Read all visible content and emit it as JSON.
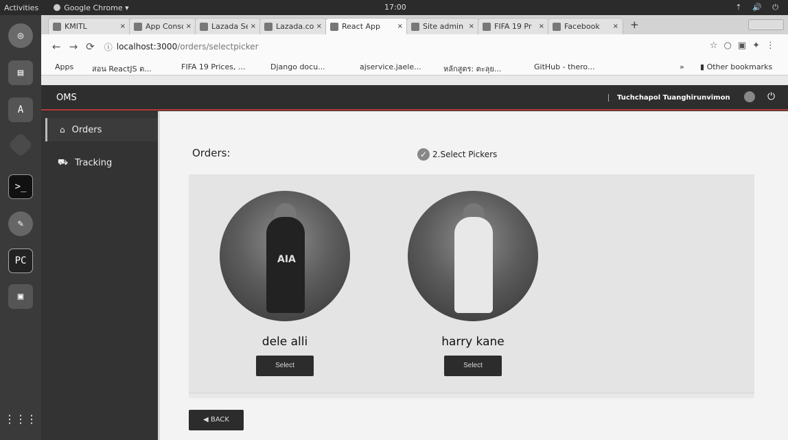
{
  "topbar": {
    "activities": "Activities",
    "app": "Google Chrome ▾",
    "clock": "17:00",
    "indicators": "⇡ 🔊 ⏻"
  },
  "browser": {
    "tabs": [
      {
        "label": "KMITL"
      },
      {
        "label": "App Conso"
      },
      {
        "label": "Lazada Sell"
      },
      {
        "label": "Lazada.co"
      },
      {
        "label": "React App",
        "active": true
      },
      {
        "label": "Site admin"
      },
      {
        "label": "FIFA 19 Pr"
      },
      {
        "label": "Facebook"
      }
    ],
    "close_glyph": "×",
    "new_tab": "+",
    "url_host": "localhost:3000",
    "url_path": "/orders/selectpicker",
    "bookmarks": [
      {
        "label": "Apps"
      },
      {
        "label": "สอน ReactJS ต..."
      },
      {
        "label": "FIFA 19 Prices, ..."
      },
      {
        "label": "Django docu..."
      },
      {
        "label": "ajservice.jaele..."
      },
      {
        "label": "หลักสูตร: ตะลุย..."
      },
      {
        "label": "GitHub - thero..."
      }
    ],
    "more_bookmarks": "»",
    "other_bookmarks": "Other bookmarks"
  },
  "app": {
    "brand": "OMS",
    "user": "Tuchchapol Tuanghirunvimon",
    "sidebar": [
      {
        "label": "Orders",
        "icon": "home-icon"
      },
      {
        "label": "Tracking",
        "icon": "truck-icon"
      }
    ],
    "main": {
      "title": "Orders:",
      "step": "2.Select Pickers",
      "pickers": [
        {
          "name": "dele alli",
          "button": "Select",
          "shirt_text": "AIA"
        },
        {
          "name": "harry kane",
          "button": "Select"
        }
      ],
      "back": "◀ BACK"
    }
  }
}
